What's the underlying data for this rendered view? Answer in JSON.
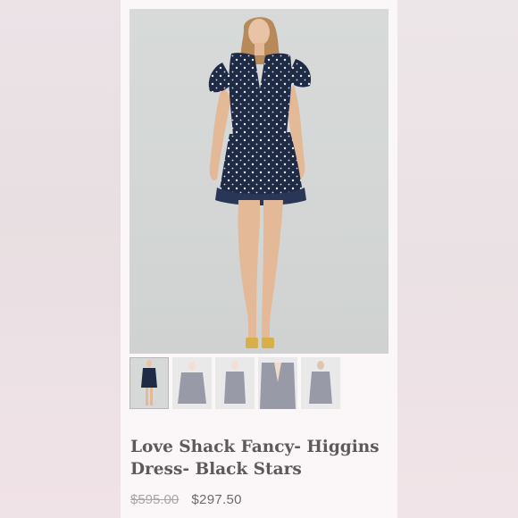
{
  "listing": {
    "title_line1": "Love Shack Fancy- Higgins",
    "title_line2": "Dress- Black Stars",
    "original_price": "$595.00",
    "sale_price": "$297.50"
  },
  "gallery": {
    "main_image": "dress-model-front-photo",
    "thumbnails": [
      "thumbnail-front",
      "thumbnail-front-pose",
      "thumbnail-side",
      "thumbnail-closeup",
      "thumbnail-back"
    ],
    "active_index": 0
  },
  "colors": {
    "dress": "#1f2a45",
    "background": "#f3e6ea",
    "title": "#5e5a5b"
  }
}
